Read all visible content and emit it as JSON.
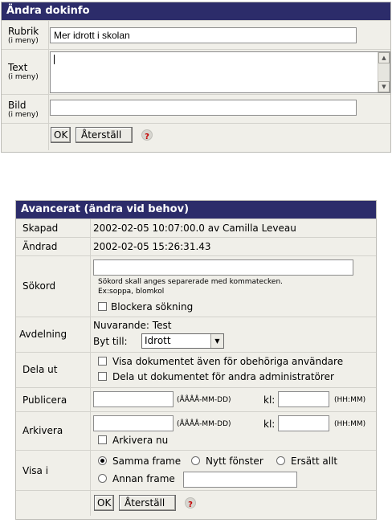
{
  "doc_panel": {
    "title": "Ändra dokinfo",
    "rubrik_label": "Rubrik",
    "rubrik_sub": "(i meny)",
    "rubrik_value": "Mer idrott i skolan",
    "text_label": "Text",
    "text_sub": "(i meny)",
    "bild_label": "Bild",
    "bild_sub": "(i meny)",
    "ok_label": "OK",
    "reset_label": "Återställ",
    "help_glyph": "?"
  },
  "adv_panel": {
    "title": "Avancerat (ändra vid behov)",
    "skapad_label": "Skapad",
    "skapad_value": "2002-02-05 10:07:00.0 av Camilla Leveau",
    "andrad_label": "Ändrad",
    "andrad_value": "2002-02-05 15:26:31.43",
    "sokord_label": "Sökord",
    "sokord_hint1": "Sökord skall anges separerade med kommatecken.",
    "sokord_hint2": "Ex:soppa, blomkol",
    "blockera_label": "Blockera sökning",
    "avdelning_label": "Avdelning",
    "nuvarande_text": "Nuvarande: Test",
    "byt_till_label": "Byt till:",
    "avdelning_selected": "Idrott",
    "dela_ut_label": "Dela ut",
    "dela_option1": "Visa dokumentet även för obehöriga användare",
    "dela_option2": "Dela ut dokumentet för andra administratörer",
    "publicera_label": "Publicera",
    "date_format": "(ÅÅÅÅ-MM-DD)",
    "kl_label": "kl:",
    "time_format": "(HH:MM)",
    "arkivera_label": "Arkivera",
    "arkivera_nu_label": "Arkivera nu",
    "visa_i_label": "Visa i",
    "visa_option1": "Samma frame",
    "visa_option2": "Nytt fönster",
    "visa_option3": "Ersätt allt",
    "visa_option4": "Annan frame",
    "ok_label": "OK",
    "reset_label": "Återställ",
    "help_glyph": "?"
  },
  "colors": {
    "title_bar": "#2c2c6a",
    "panel_bg": "#f0efe9",
    "help_icon": "#c40000"
  }
}
